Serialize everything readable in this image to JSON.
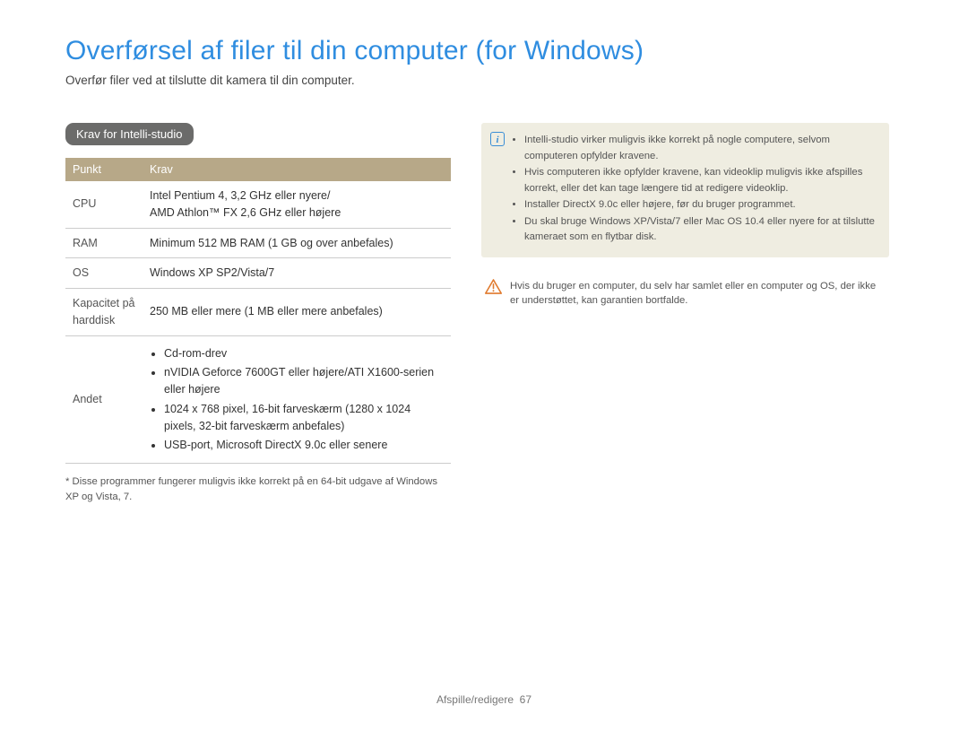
{
  "title": "Overførsel af filer til din computer (for Windows)",
  "subtitle": "Overfør filer ved at tilslutte dit kamera til din computer.",
  "section_pill": "Krav for Intelli-studio",
  "table": {
    "header_punkt": "Punkt",
    "header_krav": "Krav",
    "rows": {
      "cpu_label": "CPU",
      "cpu_value": "Intel Pentium 4, 3,2 GHz eller nyere/\nAMD Athlon™ FX 2,6 GHz eller højere",
      "ram_label": "RAM",
      "ram_value": "Minimum 512 MB RAM (1 GB og over anbefales)",
      "os_label": "OS",
      "os_value": "Windows XP SP2/Vista/7",
      "hdd_label": "Kapacitet på harddisk",
      "hdd_value": "250 MB eller mere (1 MB eller mere anbefales)",
      "other_label": "Andet",
      "other_items": [
        "Cd-rom-drev",
        "nVIDIA Geforce 7600GT eller højere/ATI X1600-serien eller højere",
        "1024 x 768 pixel, 16-bit farveskærm (1280 x 1024 pixels, 32-bit farveskærm anbefales)",
        "USB-port, Microsoft DirectX 9.0c eller senere"
      ]
    }
  },
  "footnote": "* Disse programmer fungerer muligvis ikke korrekt på en 64-bit udgave af Windows XP og Vista, 7.",
  "note_items": [
    "Intelli-studio virker muligvis ikke korrekt på nogle computere, selvom computeren opfylder kravene.",
    "Hvis computeren ikke opfylder kravene, kan videoklip muligvis ikke afspilles korrekt, eller det kan tage længere tid at redigere videoklip.",
    "Installer DirectX 9.0c eller højere, før du bruger programmet.",
    "Du skal bruge Windows XP/Vista/7 eller Mac OS 10.4 eller nyere for at tilslutte kameraet som en flytbar disk."
  ],
  "warning_text": "Hvis du bruger en computer, du selv har samlet eller en computer og OS, der ikke er understøttet, kan garantien bortfalde.",
  "footer_section": "Afspille/redigere",
  "footer_page": "67"
}
